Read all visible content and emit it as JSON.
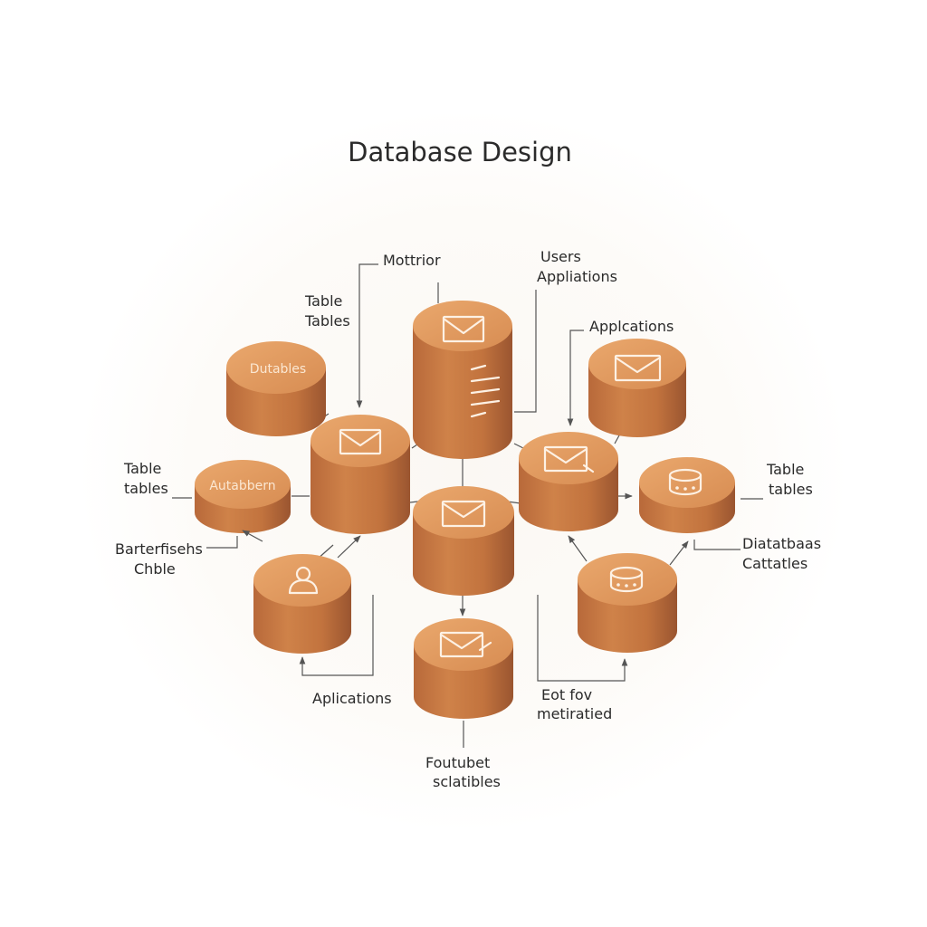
{
  "title": "Database Design",
  "nodes": {
    "databases_top_left": {
      "text": "Dutables",
      "icon": "text-label"
    },
    "databases_left": {
      "text": "Autabbern",
      "icon": "text-label"
    },
    "tall_center": {
      "icon": "envelope-icon + list-icon"
    },
    "center_left": {
      "icon": "envelope-icon"
    },
    "center": {
      "icon": "envelope-icon"
    },
    "center_right": {
      "icon": "envelope-pen-icon"
    },
    "top_right": {
      "icon": "envelope-icon"
    },
    "right": {
      "icon": "database-icon"
    },
    "bottom_left": {
      "icon": "user-icon"
    },
    "bottom_right": {
      "icon": "database-icon"
    },
    "bottom_center": {
      "icon": "envelope-pen-icon"
    }
  },
  "labels": {
    "monitor": "Mottrior",
    "table_tables_top": [
      "Table",
      "Tables"
    ],
    "users_applications": [
      "Users",
      "Appliations"
    ],
    "applications_right": "Applcations",
    "table_tables_left": [
      "Table",
      "tables"
    ],
    "partitions_table": [
      "Barterfisehs",
      "Chble"
    ],
    "table_tables_right": [
      "Table",
      "tables"
    ],
    "databases_catalogs": [
      "Diatatbaas",
      "Cattatles"
    ],
    "applications_bottom": "Aplications",
    "eot_metrics": [
      "Eot fov",
      "metiratied"
    ],
    "footer_scalables": [
      "Foutubet",
      "sclatibles"
    ]
  },
  "colors": {
    "cylinder_side": "#c4763d",
    "cylinder_top": "#e29d63",
    "connector": "#555555",
    "title": "#2b2b2b"
  }
}
